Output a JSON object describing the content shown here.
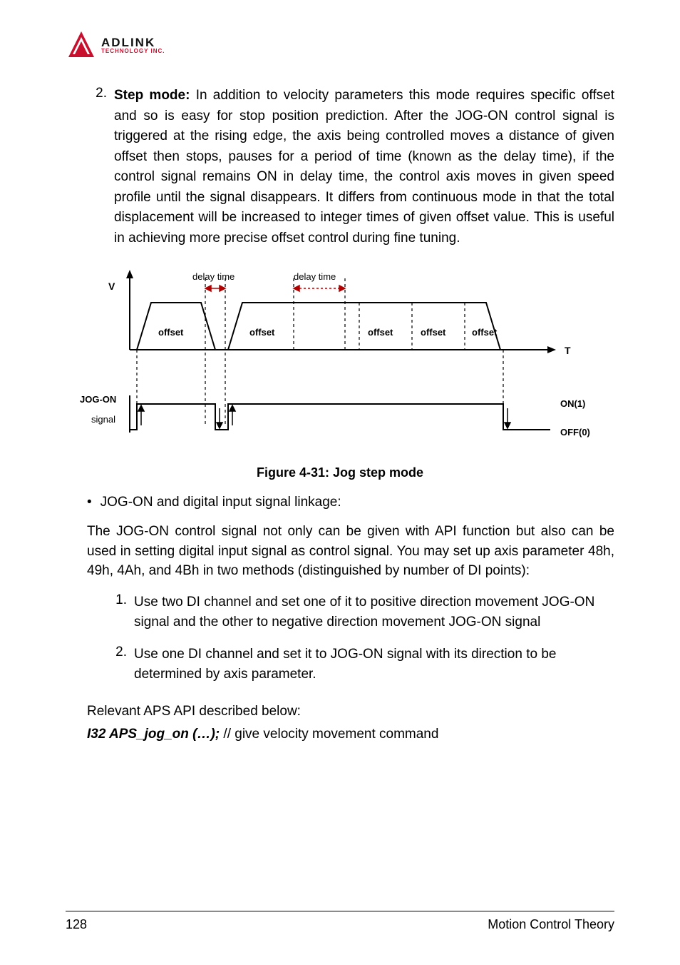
{
  "logo": {
    "main": "ADLINK",
    "sub": "TECHNOLOGY INC."
  },
  "section": {
    "item_number": "2.",
    "item_title": "Step mode:",
    "item_text": "  In addition to velocity parameters this mode requires specific offset and so is easy for stop position prediction. After the JOG-ON control signal is triggered at the rising edge, the axis being controlled moves a distance of given offset then stops, pauses for a period of time (known as the delay time), if the control signal remains ON in delay time, the control axis moves in given speed profile until the signal disappears. It differs from continuous mode in that the total displacement will be increased to integer times of given offset value. This is useful in achieving more precise offset control during fine tuning."
  },
  "figure_caption": "Figure 4-31: Jog step mode",
  "bullet": {
    "marker": "•",
    "text": "JOG-ON and digital input signal linkage:"
  },
  "para": "The JOG-ON control signal not only can be given with API function but also can be used in setting digital input signal as control signal. You may set up axis parameter 48h, 49h, 4Ah, and 4Bh in two methods (distinguished by number of DI points):",
  "methods": [
    {
      "num": "1.",
      "text": "Use two DI channel and set one of it to positive direction movement JOG-ON signal and the other to negative direction movement JOG-ON signal"
    },
    {
      "num": "2.",
      "text": "Use one DI channel and set it to JOG-ON signal with its direction to be determined by axis parameter."
    }
  ],
  "api_intro": "Relevant APS API described below:",
  "api": {
    "signature": "I32 APS_jog_on (…);",
    "comment": " // give velocity movement command"
  },
  "chart_data": {
    "type": "diagram",
    "title": "Jog step mode",
    "axes": {
      "x": "T",
      "y": "V"
    },
    "velocity_profile": {
      "segments": [
        "offset",
        "offset",
        "offset",
        "offset",
        "offset"
      ],
      "delay_markers": [
        "delay time",
        "delay time"
      ],
      "description": "Trapezoidal velocity pulses separated into equal 'offset' distance segments; dashed verticals mark segment boundaries; red arrow spans labeled 'delay time' between certain segments."
    },
    "jog_on_signal": {
      "label_left": "JOG-ON",
      "label_sub": "signal",
      "states": {
        "high": "ON(1)",
        "low": "OFF(0)"
      },
      "waveform": "two ON pulses aligned with velocity activity, OFF elsewhere; arrows on rising/falling edges"
    }
  },
  "footer": {
    "page": "128",
    "section": "Motion Control Theory"
  }
}
